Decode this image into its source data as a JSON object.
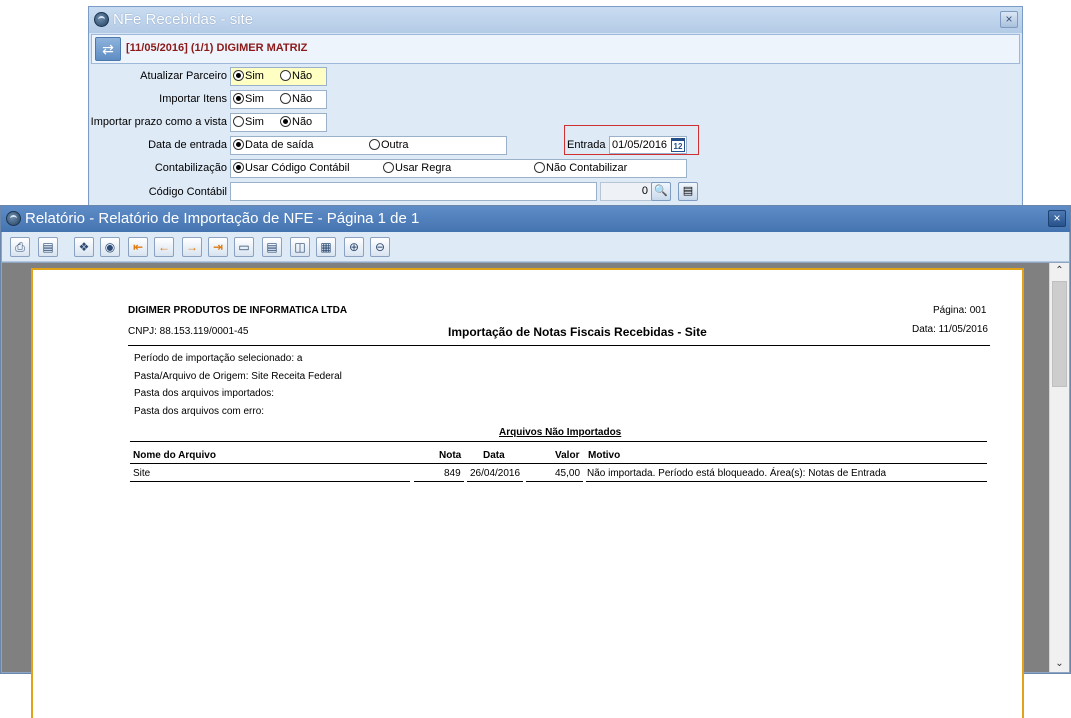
{
  "back_window": {
    "title": "NFe Recebidas - site",
    "header": "[11/05/2016] (1/1) DIGIMER MATRIZ",
    "close_label": "×",
    "swap_label": "⇄",
    "fields": {
      "atualizar_parceiro": {
        "label": "Atualizar Parceiro",
        "options": [
          "Sim",
          "Não"
        ],
        "selected": "Sim"
      },
      "importar_itens": {
        "label": "Importar Itens",
        "options": [
          "Sim",
          "Não"
        ],
        "selected": "Sim"
      },
      "importar_prazo": {
        "label": "Importar prazo como a vista",
        "options": [
          "Sim",
          "Não"
        ],
        "selected": "Não"
      },
      "data_entrada": {
        "label": "Data de entrada",
        "options": [
          "Data de saída",
          "Outra"
        ],
        "selected": "Data de saída"
      },
      "entrada": {
        "label": "Entrada",
        "value": "01/05/2016",
        "calendar_label": "12"
      },
      "contabilizacao": {
        "label": "Contabilização",
        "options": [
          "Usar Código Contábil",
          "Usar Regra",
          "Não Contabilizar"
        ],
        "selected": "Usar Código Contábil"
      },
      "codigo_contabil": {
        "label": "Código Contábil",
        "value": "",
        "number": "0"
      }
    }
  },
  "report_window": {
    "title": "Relatório - Relatório de Importação de NFE - Página 1 de 1",
    "close_label": "×",
    "toolbar_icons": [
      "print-icon",
      "export-icon",
      "search-text-icon",
      "find-icon",
      "first-page-icon",
      "previous-page-icon",
      "next-page-icon",
      "last-page-icon",
      "single-page-icon",
      "page-setup-icon",
      "two-pages-icon",
      "multi-page-icon",
      "zoom-in-icon",
      "zoom-out-icon"
    ],
    "report": {
      "company": "DIGIMER PRODUTOS DE INFORMATICA LTDA",
      "page_label": "Página: 001",
      "cnpj": "CNPJ: 88.153.119/0001-45",
      "title": "Importação de Notas Fiscais Recebidas - Site",
      "date_label": "Data: 11/05/2016",
      "info_lines": [
        "Período de importação selecionado:  a",
        "Pasta/Arquivo de Origem: Site Receita Federal",
        "Pasta dos arquivos importados:",
        "Pasta dos arquivos com erro:"
      ],
      "section_title": "Arquivos Não Importados",
      "columns": [
        "Nome do Arquivo",
        "Nota",
        "Data",
        "Valor",
        "Motivo"
      ],
      "rows": [
        [
          "Site",
          "849",
          "26/04/2016",
          "45,00",
          "Não importada. Período está bloqueado. Área(s): Notas de Entrada"
        ]
      ]
    }
  }
}
